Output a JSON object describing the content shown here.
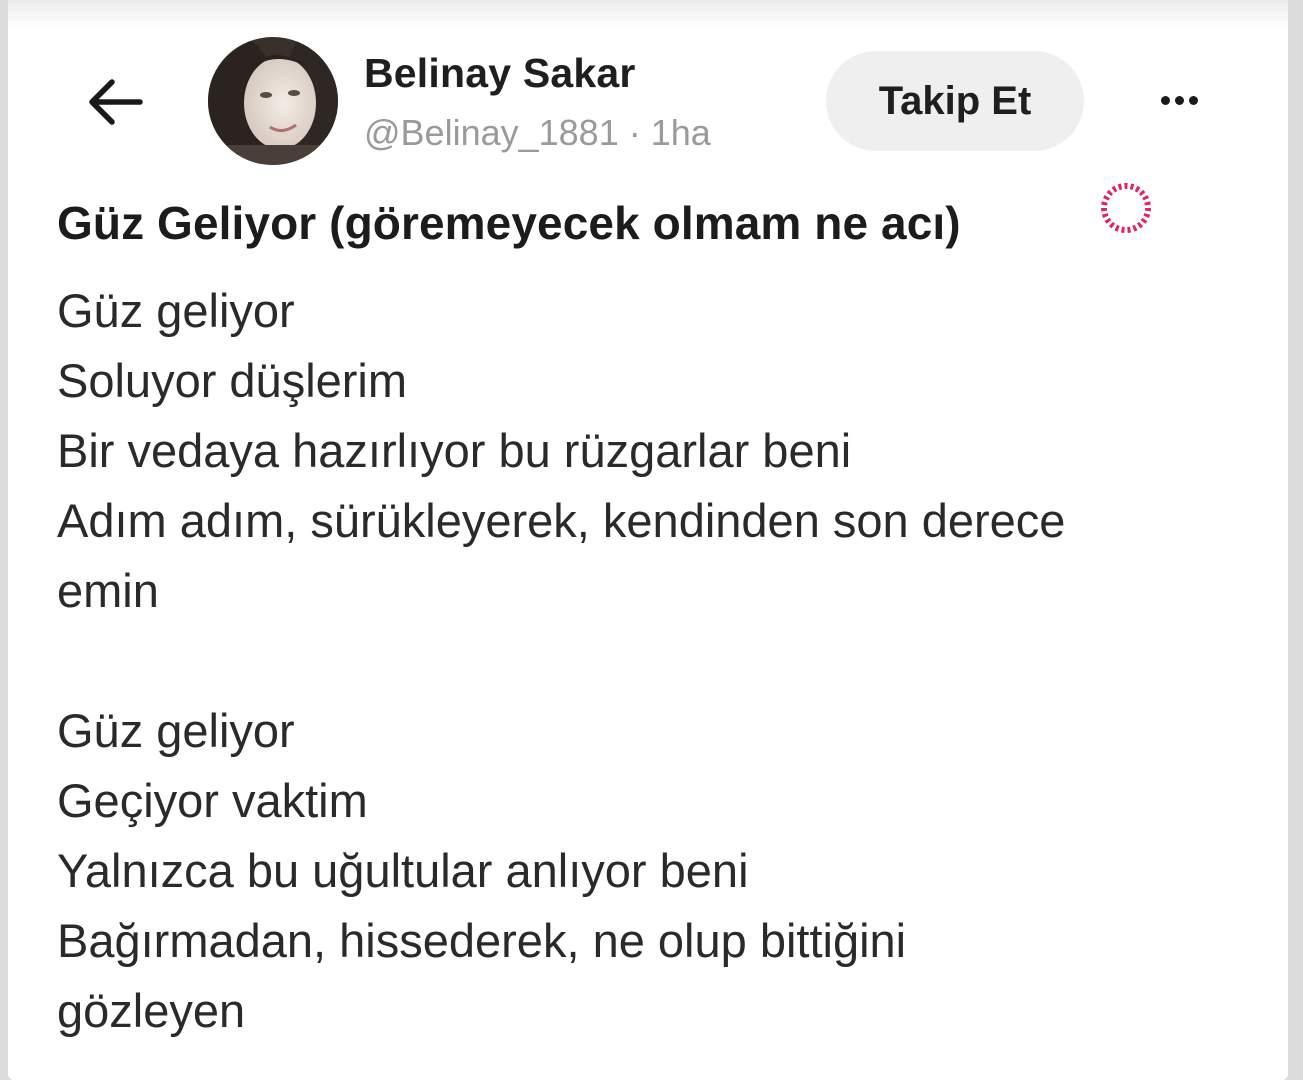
{
  "header": {
    "back_icon": "back-arrow-icon",
    "display_name": "Belinay Sakar",
    "handle": "@Belinay_1881",
    "separator": "·",
    "time_ago": "1ha",
    "follow_label": "Takip Et",
    "more_icon": "more-horizontal-icon"
  },
  "post": {
    "title": "Güz Geliyor (göremeyecek olmam ne acı)",
    "lines": [
      "Güz geliyor",
      "Soluyor düşlerim",
      "Bir vedaya hazırlıyor bu rüzgarlar beni",
      "Adım adım, sürükleyerek, kendinden son derece",
      "emin",
      "",
      "Güz geliyor",
      "Geçiyor vaktim",
      "Yalnızca bu uğultular anlıyor beni",
      "Bağırmadan, hissederek, ne olup bittiğini",
      "gözleyen"
    ]
  },
  "overlay": {
    "icon": "loading-spinner-icon",
    "color": "#e0245e"
  }
}
